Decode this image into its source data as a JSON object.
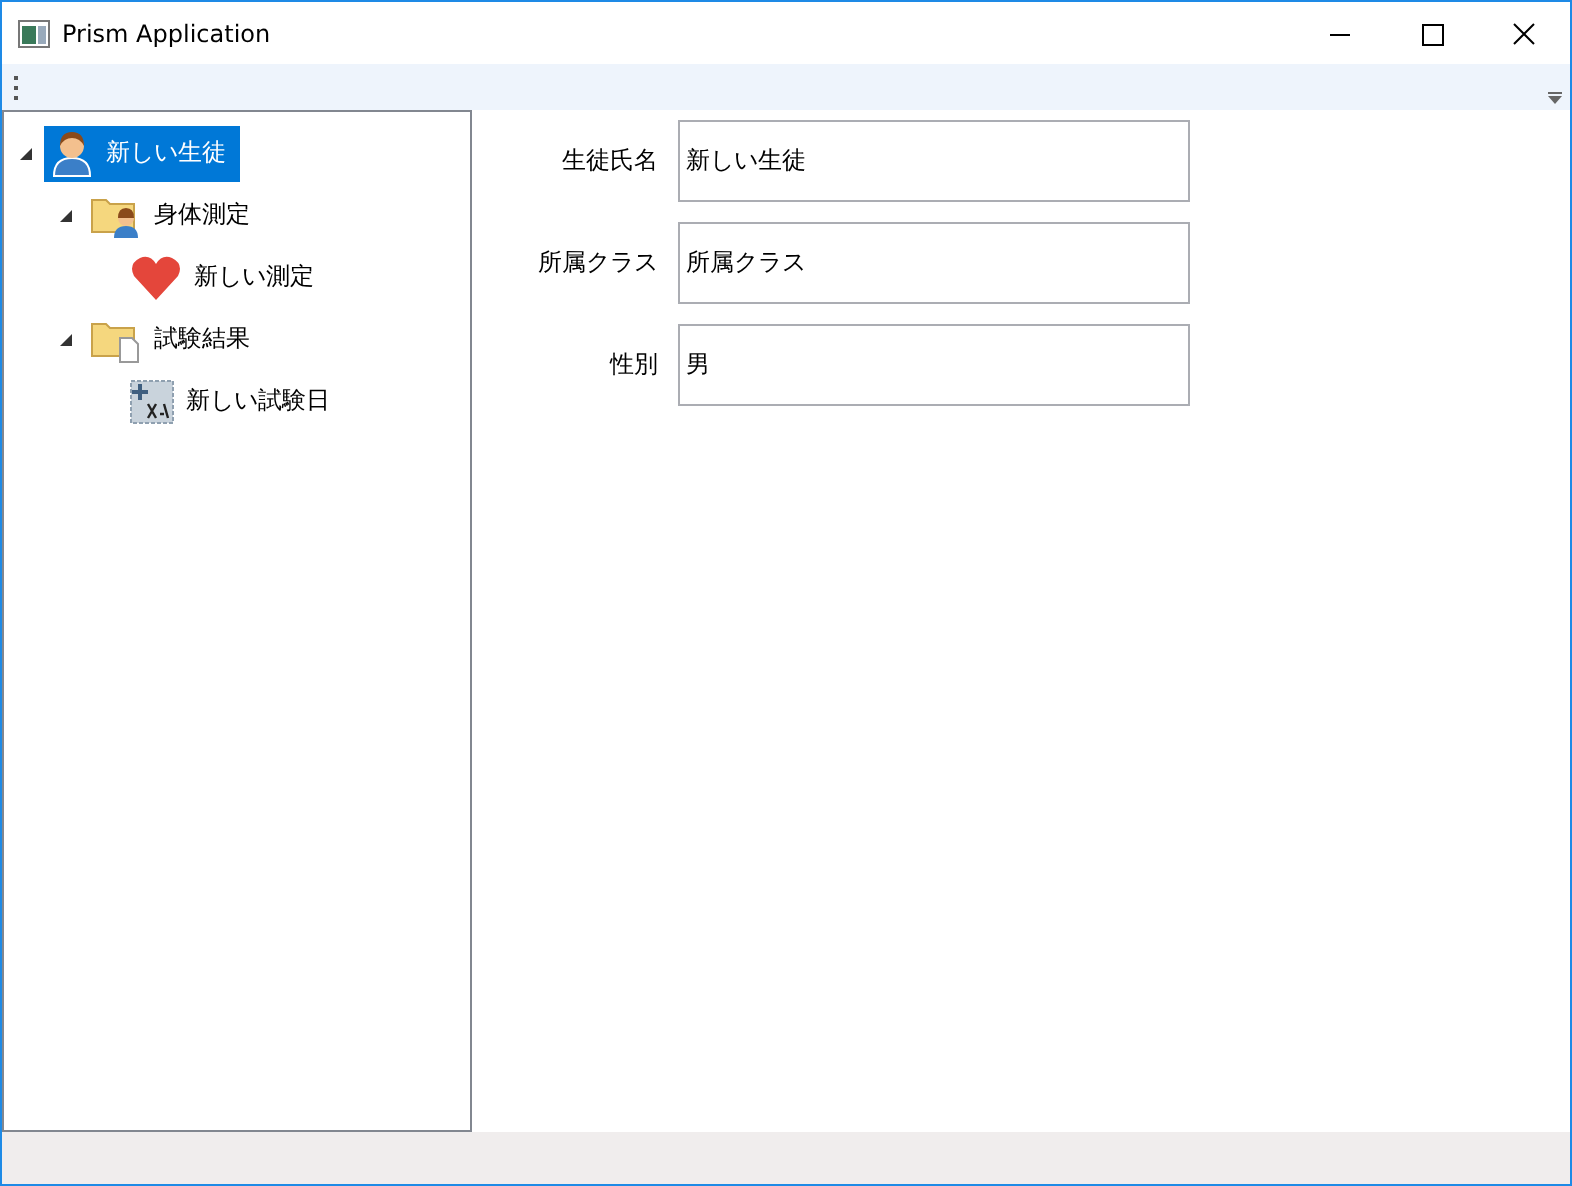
{
  "window": {
    "title": "Prism Application"
  },
  "tree": [
    {
      "label": "新しい生徒",
      "kind": "person",
      "selected": true,
      "expanded": true,
      "children": [
        {
          "label": "身体測定",
          "kind": "folder-person",
          "selected": false,
          "expanded": true,
          "children": [
            {
              "label": "新しい測定",
              "kind": "heart",
              "selected": false
            }
          ]
        },
        {
          "label": "試験結果",
          "kind": "folder-doc",
          "selected": false,
          "expanded": true,
          "children": [
            {
              "label": "新しい試験日",
              "kind": "xy",
              "selected": false
            }
          ]
        }
      ]
    }
  ],
  "form": [
    {
      "label": "生徒氏名",
      "value": "新しい生徒"
    },
    {
      "label": "所属クラス",
      "value": "所属クラス"
    },
    {
      "label": "性別",
      "value": "男"
    }
  ]
}
